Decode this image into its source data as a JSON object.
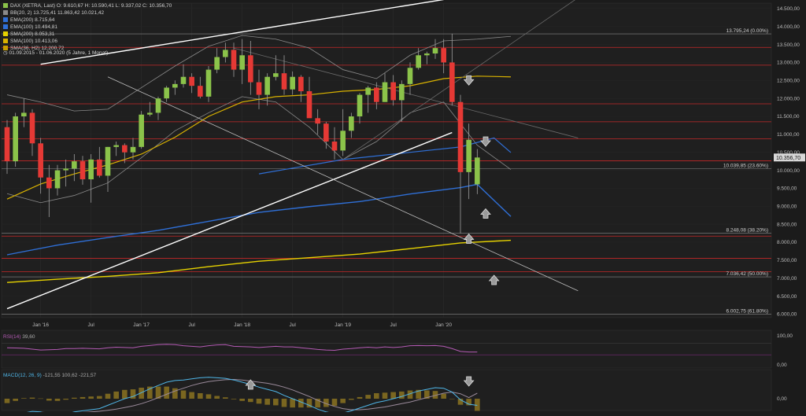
{
  "legend": {
    "instrument": {
      "label": "DAX (XETRA, Last)",
      "values": "O: 9.610,67  H: 10.590,41  L: 9.337,02  C: 10.356,70",
      "color": "#8bc34a"
    },
    "bb": {
      "label": "BB(20, 2)",
      "values": "13.725,41  11.863,42  10.021,42",
      "color": "#8a8a8a"
    },
    "ema200": {
      "label": "EMA(200)",
      "values": "8.715,64",
      "color": "#2f6fd6"
    },
    "ema100": {
      "label": "EMA(100)",
      "values": "10.494,81",
      "color": "#2f6fd6"
    },
    "sma200": {
      "label": "SMA(200)",
      "values": "8.053,31",
      "color": "#e6d200"
    },
    "sma100": {
      "label": "SMA(100)",
      "values": "10.413,06",
      "color": "#d9b200"
    },
    "sma36": {
      "label": "SMA(36, H2)",
      "values": "12.200,72",
      "color": "#c8a000"
    }
  },
  "period": "01.09.2015 - 01.06.2020  (5 Jahre, 1 Monat)",
  "colors": {
    "up": "#8bc34a",
    "down": "#e53935",
    "fib": "#c62828",
    "trend": "#ffffff",
    "bb": "#8a8a8a",
    "ema": "#2f6fd6",
    "sma200": "#e6d200",
    "sma100": "#d9b200",
    "rsi": "#b45ab4",
    "macd": "#4fb6e8",
    "signal": "#9a8a9a",
    "hist": "#7a6620"
  },
  "price_tag": "10.356,70",
  "chart_data": {
    "type": "candlestick",
    "x_labels": [
      "Jan '16",
      "Jul",
      "Jan '17",
      "Jul",
      "Jan '18",
      "Jul",
      "Jan '19",
      "Jul",
      "Jan '20"
    ],
    "x_label_months": [
      4,
      10,
      16,
      22,
      28,
      34,
      40,
      46,
      52
    ],
    "y_ticks": [
      "14.500,00",
      "14.000,00",
      "13.500,00",
      "13.000,00",
      "12.500,00",
      "12.000,00",
      "11.500,00",
      "11.000,00",
      "10.500,00",
      "10.000,00",
      "9.500,00",
      "9.000,00",
      "8.500,00",
      "8.000,00",
      "7.500,00",
      "7.000,00",
      "6.500,00",
      "6.000,00"
    ],
    "y_tick_values": [
      14500,
      14000,
      13500,
      13000,
      12500,
      12000,
      11500,
      11000,
      10500,
      10000,
      9500,
      9000,
      8500,
      8000,
      7500,
      7000,
      6500,
      6000
    ],
    "ylim": [
      5900,
      14650
    ],
    "fib_levels": [
      {
        "value": 13795.24,
        "label": "13.795,24 (0.00%)",
        "color": "#8a8a8a"
      },
      {
        "value": 10039.85,
        "label": "10.039,85 (23.60%)",
        "color": "#8a8a8a"
      },
      {
        "value": 8248.08,
        "label": "8.248,08 (38.20%)",
        "color": "#8a8a8a"
      },
      {
        "value": 7036.42,
        "label": "7.036,42 (50.00%)",
        "color": "#8a8a8a"
      },
      {
        "value": 6002.75,
        "label": "6.002,75 (61.80%)",
        "color": "#8a8a8a"
      }
    ],
    "horizontal_lines": [
      13420,
      12925,
      11850,
      11350,
      10880,
      10265,
      8170,
      7550,
      7180
    ],
    "candles": [
      [
        11200,
        11400,
        9900,
        10250
      ],
      [
        10250,
        11600,
        10100,
        11500
      ],
      [
        11500,
        12000,
        11200,
        11600
      ],
      [
        11600,
        11700,
        10400,
        10750
      ],
      [
        10750,
        10900,
        9350,
        9800
      ],
      [
        9800,
        10150,
        8700,
        9500
      ],
      [
        9500,
        10150,
        9300,
        10000
      ],
      [
        10000,
        10300,
        9550,
        10050
      ],
      [
        10050,
        10450,
        9700,
        10250
      ],
      [
        10250,
        10400,
        9600,
        9750
      ],
      [
        9750,
        10450,
        9100,
        10300
      ],
      [
        10300,
        10650,
        9800,
        9850
      ],
      [
        9850,
        10650,
        9400,
        10650
      ],
      [
        10650,
        10800,
        10400,
        10700
      ],
      [
        10700,
        10750,
        10200,
        10500
      ],
      [
        10500,
        10900,
        10300,
        10650
      ],
      [
        10650,
        11650,
        10600,
        11550
      ],
      [
        11550,
        11900,
        11500,
        11600
      ],
      [
        11600,
        12050,
        11400,
        12000
      ],
      [
        12000,
        12350,
        11900,
        12300
      ],
      [
        12300,
        12500,
        12100,
        12400
      ],
      [
        12400,
        12950,
        12300,
        12600
      ],
      [
        12600,
        12700,
        12150,
        12350
      ],
      [
        12350,
        12600,
        12000,
        12050
      ],
      [
        12050,
        12900,
        11900,
        12800
      ],
      [
        12800,
        13400,
        12700,
        13150
      ],
      [
        13150,
        13550,
        13000,
        13350
      ],
      [
        13350,
        13550,
        12600,
        12800
      ],
      [
        12800,
        13650,
        12400,
        13200
      ],
      [
        13200,
        13600,
        12100,
        12450
      ],
      [
        12450,
        12800,
        11700,
        12100
      ],
      [
        12100,
        12700,
        11800,
        12600
      ],
      [
        12600,
        13200,
        12500,
        12700
      ],
      [
        12700,
        13200,
        12100,
        12250
      ],
      [
        12250,
        12750,
        12100,
        12600
      ],
      [
        12600,
        12650,
        11900,
        12200
      ],
      [
        12200,
        12600,
        11500,
        11450
      ],
      [
        11450,
        11700,
        11000,
        11300
      ],
      [
        11300,
        11350,
        10600,
        10800
      ],
      [
        10800,
        11200,
        10300,
        10550
      ],
      [
        10550,
        11700,
        10400,
        11100
      ],
      [
        11100,
        11600,
        10900,
        11500
      ],
      [
        11500,
        12150,
        11300,
        12100
      ],
      [
        12100,
        12350,
        11600,
        12300
      ],
      [
        12300,
        12450,
        11700,
        11900
      ],
      [
        11900,
        12700,
        11900,
        12450
      ],
      [
        12450,
        12650,
        11800,
        11950
      ],
      [
        11950,
        12500,
        11350,
        12400
      ],
      [
        12400,
        13000,
        12100,
        12850
      ],
      [
        12850,
        13400,
        12800,
        13200
      ],
      [
        13200,
        13300,
        12950,
        13250
      ],
      [
        13250,
        13650,
        13100,
        13400
      ],
      [
        13400,
        13650,
        12700,
        13000
      ],
      [
        13000,
        13800,
        11800,
        11900
      ],
      [
        11900,
        12100,
        8250,
        9950
      ],
      [
        9950,
        11300,
        9200,
        10850
      ],
      [
        9610,
        10590,
        9337,
        10356
      ]
    ],
    "sma200": [
      [
        0,
        6880
      ],
      [
        6,
        6970
      ],
      [
        12,
        7050
      ],
      [
        18,
        7150
      ],
      [
        24,
        7320
      ],
      [
        30,
        7470
      ],
      [
        36,
        7570
      ],
      [
        42,
        7670
      ],
      [
        48,
        7820
      ],
      [
        54,
        7980
      ],
      [
        60,
        8053
      ]
    ],
    "ema200": [
      [
        0,
        7650
      ],
      [
        6,
        7920
      ],
      [
        12,
        8130
      ],
      [
        18,
        8330
      ],
      [
        24,
        8580
      ],
      [
        30,
        8830
      ],
      [
        36,
        8990
      ],
      [
        42,
        9130
      ],
      [
        48,
        9340
      ],
      [
        54,
        9520
      ],
      [
        56,
        9610
      ],
      [
        60,
        8716
      ]
    ],
    "sma100_ema100_ma": [
      [
        0,
        9200
      ],
      [
        4,
        9620
      ],
      [
        8,
        9900
      ],
      [
        12,
        10150
      ],
      [
        16,
        10450
      ],
      [
        20,
        10920
      ],
      [
        24,
        11500
      ],
      [
        28,
        11900
      ],
      [
        32,
        12050
      ],
      [
        36,
        12100
      ],
      [
        40,
        12200
      ],
      [
        44,
        12250
      ],
      [
        48,
        12350
      ],
      [
        52,
        12550
      ],
      [
        56,
        12620
      ],
      [
        60,
        12600
      ]
    ],
    "ema100_blue": [
      [
        30,
        9900
      ],
      [
        40,
        10300
      ],
      [
        48,
        10500
      ],
      [
        54,
        10650
      ],
      [
        58,
        10900
      ],
      [
        60,
        10495
      ]
    ],
    "bb_upper": [
      [
        0,
        12100
      ],
      [
        4,
        11900
      ],
      [
        8,
        11650
      ],
      [
        12,
        11700
      ],
      [
        16,
        12300
      ],
      [
        20,
        12900
      ],
      [
        24,
        13450
      ],
      [
        28,
        13750
      ],
      [
        32,
        13650
      ],
      [
        36,
        13400
      ],
      [
        40,
        12800
      ],
      [
        44,
        12550
      ],
      [
        48,
        13200
      ],
      [
        52,
        13600
      ],
      [
        56,
        13650
      ],
      [
        60,
        13725
      ]
    ],
    "bb_lower": [
      [
        0,
        9350
      ],
      [
        4,
        9100
      ],
      [
        8,
        9300
      ],
      [
        12,
        9650
      ],
      [
        16,
        10350
      ],
      [
        20,
        11100
      ],
      [
        24,
        11600
      ],
      [
        28,
        12050
      ],
      [
        32,
        11900
      ],
      [
        36,
        11200
      ],
      [
        40,
        10300
      ],
      [
        44,
        10800
      ],
      [
        48,
        11600
      ],
      [
        52,
        11900
      ],
      [
        56,
        10700
      ],
      [
        60,
        10021
      ]
    ],
    "trendlines": [
      {
        "from": [
          0,
          6150
        ],
        "to": [
          53,
          11050
        ],
        "color": "#ffffff",
        "label": ""
      },
      {
        "from": [
          4,
          12950
        ],
        "to": [
          52,
          14750
        ],
        "color": "#ffffff",
        "label": ""
      },
      {
        "from": [
          12,
          12600
        ],
        "to": [
          68,
          6650
        ],
        "color": "#bdbdbd",
        "label": ""
      },
      {
        "from": [
          27,
          13400
        ],
        "to": [
          68,
          10900
        ],
        "color": "#6a6a6a",
        "label": ""
      },
      {
        "from": [
          40,
          10300
        ],
        "to": [
          68,
          14800
        ],
        "color": "#6a6a6a",
        "label": ""
      }
    ],
    "arrows": [
      {
        "month": 55,
        "value": 12500,
        "dir": "down"
      },
      {
        "month": 57,
        "value": 10800,
        "dir": "down"
      },
      {
        "month": 57,
        "value": 8800,
        "dir": "up"
      },
      {
        "month": 55,
        "value": 8100,
        "dir": "up"
      },
      {
        "month": 58,
        "value": 6950,
        "dir": "up"
      }
    ],
    "rsi": {
      "label": "RSI(14)",
      "value": "39,60",
      "ticks": [
        "100,00",
        "0,00"
      ],
      "values": [
        55,
        54,
        53,
        50,
        47,
        48,
        49,
        52,
        52,
        53,
        52,
        51,
        55,
        57,
        56,
        55,
        60,
        63,
        66,
        67,
        66,
        62,
        60,
        58,
        62,
        65,
        66,
        60,
        59,
        58,
        56,
        58,
        60,
        58,
        58,
        55,
        52,
        49,
        47,
        46,
        50,
        52,
        55,
        57,
        55,
        58,
        56,
        58,
        62,
        63,
        62,
        63,
        60,
        52,
        42,
        40,
        40
      ]
    },
    "macd": {
      "label": "MACD(12, 26, 9)",
      "values_text": "-121,55  100,62  -221,57",
      "tick": "0,00",
      "macd": [
        -380,
        -330,
        -260,
        -230,
        -240,
        -290,
        -300,
        -280,
        -240,
        -220,
        -200,
        -180,
        -120,
        -60,
        0,
        40,
        110,
        180,
        240,
        300,
        330,
        340,
        360,
        380,
        390,
        380,
        370,
        340,
        300,
        260,
        210,
        170,
        130,
        60,
        0,
        -60,
        -120,
        -190,
        -240,
        -270,
        -260,
        -220,
        -170,
        -120,
        -70,
        -40,
        0,
        40,
        90,
        140,
        170,
        200,
        190,
        120,
        -20,
        -100,
        -121
      ],
      "signal": [
        -300,
        -290,
        -270,
        -250,
        -245,
        -255,
        -260,
        -262,
        -258,
        -250,
        -240,
        -228,
        -210,
        -190,
        -160,
        -130,
        -90,
        -40,
        20,
        80,
        140,
        190,
        240,
        280,
        310,
        330,
        345,
        350,
        340,
        320,
        300,
        280,
        250,
        210,
        160,
        100,
        40,
        -30,
        -90,
        -140,
        -180,
        -200,
        -200,
        -190,
        -170,
        -150,
        -120,
        -90,
        -60,
        -20,
        20,
        60,
        100,
        120,
        90,
        20,
        100
      ]
    }
  }
}
